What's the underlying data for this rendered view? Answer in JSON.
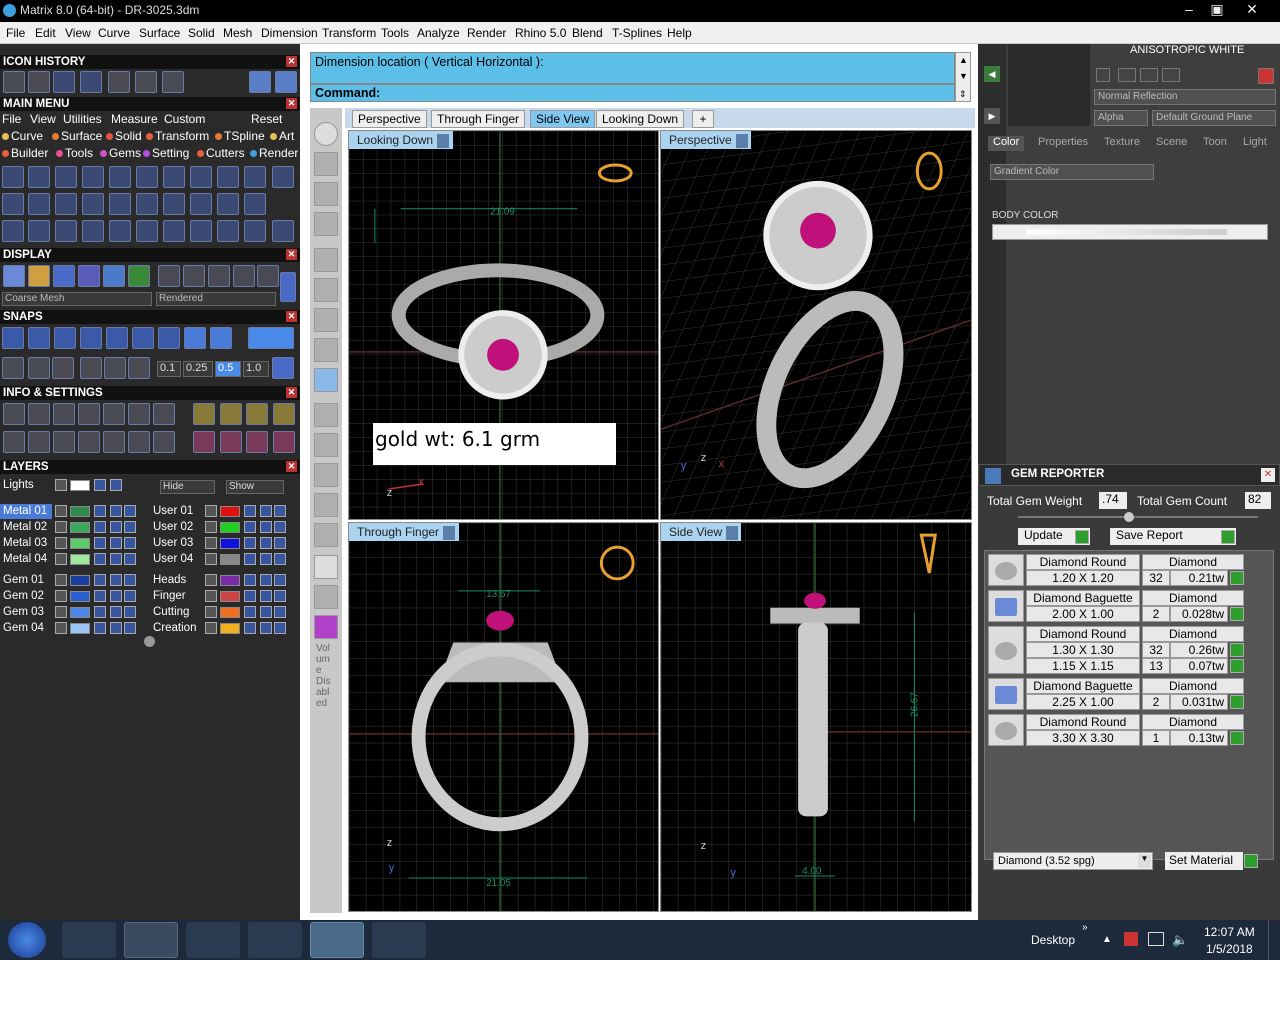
{
  "window": {
    "title": "Matrix 8.0 (64-bit) - DR-3025.3dm"
  },
  "menu": [
    "File",
    "Edit",
    "View",
    "Curve",
    "Surface",
    "Solid",
    "Mesh",
    "Dimension",
    "Transform",
    "Tools",
    "Analyze",
    "Render",
    "Rhino 5.0",
    "Blend",
    "T-Splines",
    "Help"
  ],
  "left": {
    "icon_history": "ICON HISTORY",
    "main_menu": "MAIN MENU",
    "mm_row1": [
      "File",
      "View",
      "Utilities",
      "Measure",
      "Custom",
      "Reset"
    ],
    "mm_row2": [
      "Curve",
      "Surface",
      "Solid",
      "Transform",
      "TSpline",
      "Art"
    ],
    "mm_row3": [
      "Builder",
      "Tools",
      "Gems",
      "Setting",
      "Cutters",
      "Render"
    ],
    "display": "DISPLAY",
    "display_mesh": "Coarse Mesh",
    "display_mode": "Rendered",
    "snaps": "SNAPS",
    "snap_values": [
      "0.1",
      "0.25",
      "0.5",
      "1.0"
    ],
    "info_settings": "INFO & SETTINGS",
    "layers": "LAYERS",
    "lights": "Lights",
    "hide": "Hide",
    "show": "Show",
    "layers_left": [
      "Metal 01",
      "Metal 02",
      "Metal 03",
      "Metal 04",
      "Gem 01",
      "Gem 02",
      "Gem 03",
      "Gem 04"
    ],
    "layers_right": [
      "User 01",
      "User 02",
      "User 03",
      "User 04",
      "Heads",
      "Finger",
      "Cutting",
      "Creation"
    ],
    "layer_colors_left": [
      "#2d8a4a",
      "#39a85a",
      "#5ccc6a",
      "#9ee89e",
      "#1a3ea0",
      "#2a5fd0",
      "#4a86e8",
      "#9cc4f4"
    ],
    "layer_colors_right": [
      "#e01010",
      "#20d020",
      "#1010e0",
      "#888888",
      "#7a2aa8",
      "#c44",
      "#f07020",
      "#f0b020"
    ]
  },
  "command": {
    "prompt": "Dimension location ( Vertical  Horizontal ):",
    "label": "Command:"
  },
  "tabs": [
    "Perspective",
    "Through Finger",
    "Side View",
    "Looking Down"
  ],
  "active_tab": "Side View",
  "viewports": {
    "tl": "Looking Down",
    "tr": "Perspective",
    "bl": "Through Finger",
    "br": "Side View"
  },
  "annotation": "gold wt: 6.1 grm",
  "dims": {
    "tl_w": "21.09",
    "bl_top": "13.67",
    "bl_bottom": "21.05",
    "br_h": "26.67",
    "br_bottom": "4.00"
  },
  "vtool_text": "Vol um e Dis abl ed",
  "right": {
    "material": "ANISOTROPIC WHITE",
    "reflection": "Normal Reflection",
    "alpha": "Alpha",
    "ground": "Default Ground Plane",
    "tabs": [
      "Color",
      "Properties",
      "Texture",
      "Scene",
      "Toon",
      "Light"
    ],
    "gradient": "Gradient Color",
    "body_color": "BODY COLOR"
  },
  "gem_reporter": {
    "title": "GEM REPORTER",
    "total_weight_label": "Total Gem Weight",
    "total_weight": ".74",
    "total_count_label": "Total Gem Count",
    "total_count": "82",
    "update": "Update",
    "save_report": "Save Report",
    "rows": [
      {
        "shape": "Diamond Round",
        "material": "Diamond",
        "size": "1.20 X 1.20",
        "count": "32",
        "wt": "0.21tw"
      },
      {
        "shape": "Diamond Baguette",
        "material": "Diamond",
        "size": "2.00 X 1.00",
        "count": "2",
        "wt": "0.028tw"
      },
      {
        "shape": "Diamond Round",
        "material": "Diamond",
        "size": "1.30 X 1.30",
        "count": "32",
        "wt": "0.26tw",
        "size2": "1.15 X 1.15",
        "count2": "13",
        "wt2": "0.07tw"
      },
      {
        "shape": "Diamond Baguette",
        "material": "Diamond",
        "size": "2.25 X 1.00",
        "count": "2",
        "wt": "0.031tw"
      },
      {
        "shape": "Diamond Round",
        "material": "Diamond",
        "size": "3.30 X 3.30",
        "count": "1",
        "wt": "0.13tw"
      }
    ],
    "material_select": "Diamond   (3.52 spg)",
    "set_material": "Set Material"
  },
  "taskbar": {
    "desktop": "Desktop",
    "time": "12:07 AM",
    "date": "1/5/2018"
  }
}
